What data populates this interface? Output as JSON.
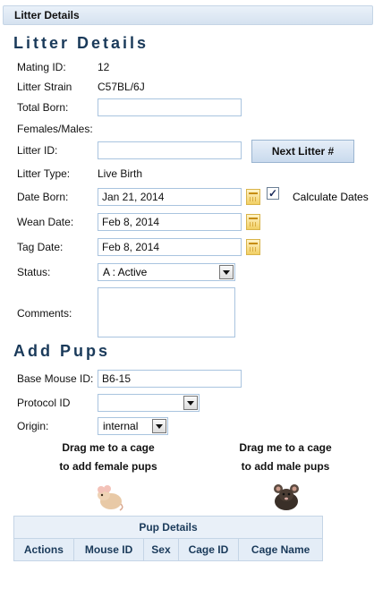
{
  "panel": {
    "title": "Litter Details"
  },
  "litter_section": {
    "title": "Litter Details",
    "mating_id_label": "Mating ID:",
    "mating_id_value": "12",
    "litter_strain_label": "Litter Strain",
    "litter_strain_value": "C57BL/6J",
    "total_born_label": "Total Born:",
    "total_born_value": "",
    "females_males_label": "Females/Males:",
    "litter_id_label": "Litter ID:",
    "litter_id_value": "",
    "next_litter_button": "Next Litter #",
    "litter_type_label": "Litter Type:",
    "litter_type_value": "Live Birth",
    "date_born_label": "Date Born:",
    "date_born_value": "Jan 21, 2014",
    "calculate_dates_label": "Calculate Dates",
    "calculate_dates_checked": true,
    "wean_date_label": "Wean Date:",
    "wean_date_value": "Feb 8, 2014",
    "tag_date_label": "Tag Date:",
    "tag_date_value": "Feb 8, 2014",
    "status_label": "Status:",
    "status_value": "A : Active",
    "comments_label": "Comments:",
    "comments_value": ""
  },
  "pups_section": {
    "title": "Add Pups",
    "base_mouse_id_label": "Base Mouse ID:",
    "base_mouse_id_value": "B6-15",
    "protocol_id_label": "Protocol ID",
    "protocol_id_value": "",
    "origin_label": "Origin:",
    "origin_value": "internal",
    "drag_female_line1": "Drag me to a cage",
    "drag_female_line2": "to add female pups",
    "drag_male_line1": "Drag me to a cage",
    "drag_male_line2": "to add male pups"
  },
  "pup_table": {
    "caption": "Pup Details",
    "columns": [
      "Actions",
      "Mouse ID",
      "Sex",
      "Cage ID",
      "Cage Name"
    ]
  },
  "colors": {
    "accent": "#1a3a5a",
    "header_bg": "#d5e2f0",
    "input_border": "#a9c4df"
  }
}
